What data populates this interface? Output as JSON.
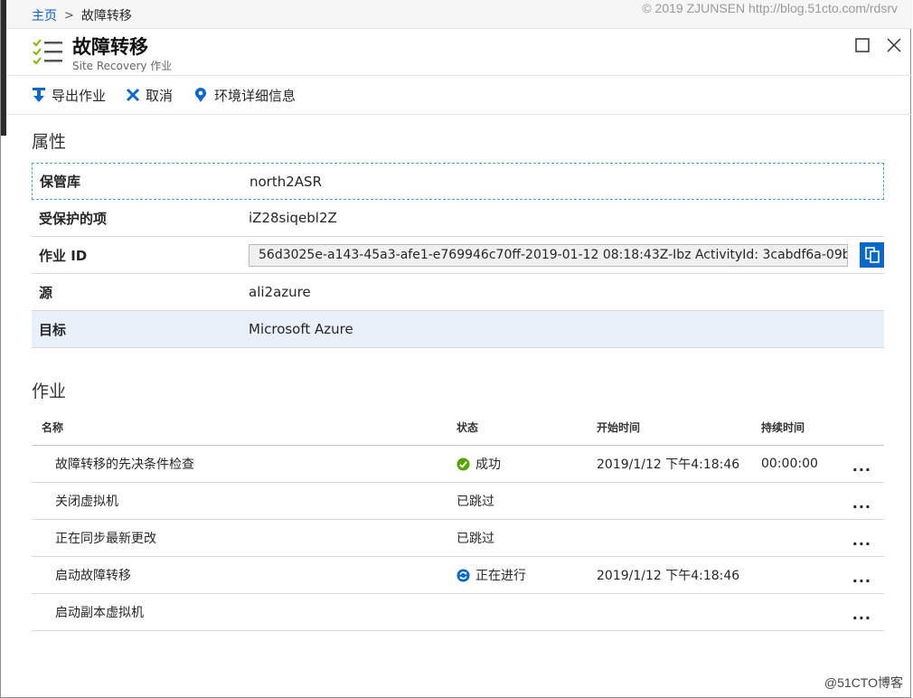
{
  "breadcrumb": {
    "home": "主页",
    "current": "故障转移"
  },
  "watermark": "© 2019 ZJUNSEN http://blog.51cto.com/rdsrv",
  "header": {
    "title": "故障转移",
    "subtitle": "Site Recovery 作业"
  },
  "toolbar": {
    "export": "导出作业",
    "cancel": "取消",
    "details": "环境详细信息"
  },
  "properties": {
    "title": "属性",
    "rows": [
      {
        "key": "保管库",
        "value": "north2ASR"
      },
      {
        "key": "受保护的项",
        "value": "iZ28siqebl2Z"
      },
      {
        "key": "作业 ID",
        "value": "56d3025e-a143-45a3-afe1-e769946c70ff-2019-01-12 08:18:43Z-Ibz ActivityId: 3cabdf6a-09b..."
      },
      {
        "key": "源",
        "value": "ali2azure"
      },
      {
        "key": "目标",
        "value": "Microsoft Azure"
      }
    ]
  },
  "jobs": {
    "title": "作业",
    "headers": {
      "name": "名称",
      "status": "状态",
      "start": "开始时间",
      "duration": "持续时间"
    },
    "rows": [
      {
        "name": "故障转移的先决条件检查",
        "status": "成功",
        "status_icon": "success-icon",
        "start": "2019/1/12 下午4:18:46",
        "duration": "00:00:00",
        "more": "..."
      },
      {
        "name": "关闭虚拟机",
        "status": "已跳过",
        "status_icon": "",
        "start": "",
        "duration": "",
        "more": "..."
      },
      {
        "name": "正在同步最新更改",
        "status": "已跳过",
        "status_icon": "",
        "start": "",
        "duration": "",
        "more": "..."
      },
      {
        "name": "启动故障转移",
        "status": "正在进行",
        "status_icon": "in-progress-icon",
        "start": "2019/1/12 下午4:18:46",
        "duration": "",
        "more": "..."
      },
      {
        "name": "启动副本虚拟机",
        "status": "",
        "status_icon": "",
        "start": "",
        "duration": "",
        "more": "..."
      }
    ]
  },
  "footer_logo": "@51CTO博客",
  "colors": {
    "link": "#015cda",
    "accent": "#0a68c8",
    "success": "#57a300",
    "progress": "#0a68c8"
  }
}
